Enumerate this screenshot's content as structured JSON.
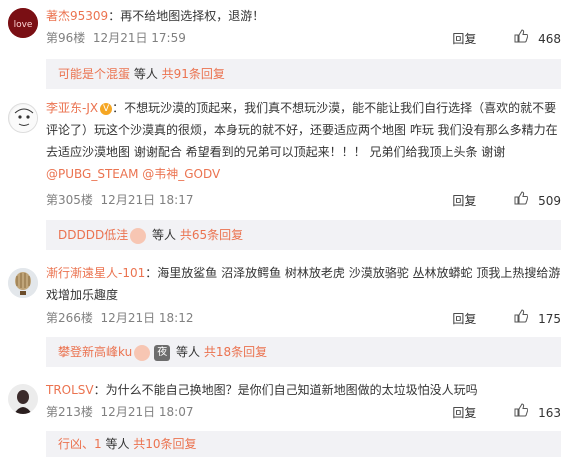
{
  "comments": [
    {
      "user": "著杰95309",
      "text": "：再不给地图选择权，退游！",
      "floor": "第96楼",
      "time": "12月21日 17:59",
      "reply": "回复",
      "likes": "468",
      "sub": {
        "names": "可能是个混蛋",
        "mid": " 等人 ",
        "count": "共91条回复"
      }
    },
    {
      "user": "李亚东-JX",
      "text": "：不想玩沙漠的顶起来，我们真不想玩沙漠，能不能让我们自行选择（喜欢的就不要评论了）玩这个沙漠真的很烦，本身玩的就不好，还要适应两个地图 咋玩 我们没有那么多精力在去适应沙漠地图 谢谢配合 希望看到的兄弟可以顶起来！！！ 兄弟们给我顶上头条 谢谢",
      "mentions": "@PUBG_STEAM @韦神_GODV",
      "floor": "第305楼",
      "time": "12月21日 18:17",
      "reply": "回复",
      "likes": "509",
      "sub": {
        "names": "DDDDD低洼",
        "mid": " 等人 ",
        "count": "共65条回复"
      }
    },
    {
      "user": "漸行漸遠星人-101",
      "text": "：海里放鲨鱼 沼泽放鳄鱼 树林放老虎 沙漠放骆驼 丛林放蟒蛇 顶我上热搜给游戏增加乐趣度",
      "floor": "第266楼",
      "time": "12月21日 18:12",
      "reply": "回复",
      "likes": "175",
      "sub": {
        "names": "攀登新高峰ku",
        "mid": " 等人 ",
        "count": "共18条回复",
        "emoji_text": "夜"
      }
    },
    {
      "user": "TROLSV",
      "text": "：为什么不能自己换地图？是你们自己知道新地图做的太垃圾怕没人玩吗",
      "floor": "第213楼",
      "time": "12月21日 18:07",
      "reply": "回复",
      "likes": "163",
      "sub": {
        "names": "行凶、1",
        "mid": " 等人 ",
        "count": "共10条回复"
      }
    }
  ],
  "colors": {
    "accent": "#eb7350",
    "meta": "#808080",
    "subbg": "#f2f2f5"
  }
}
